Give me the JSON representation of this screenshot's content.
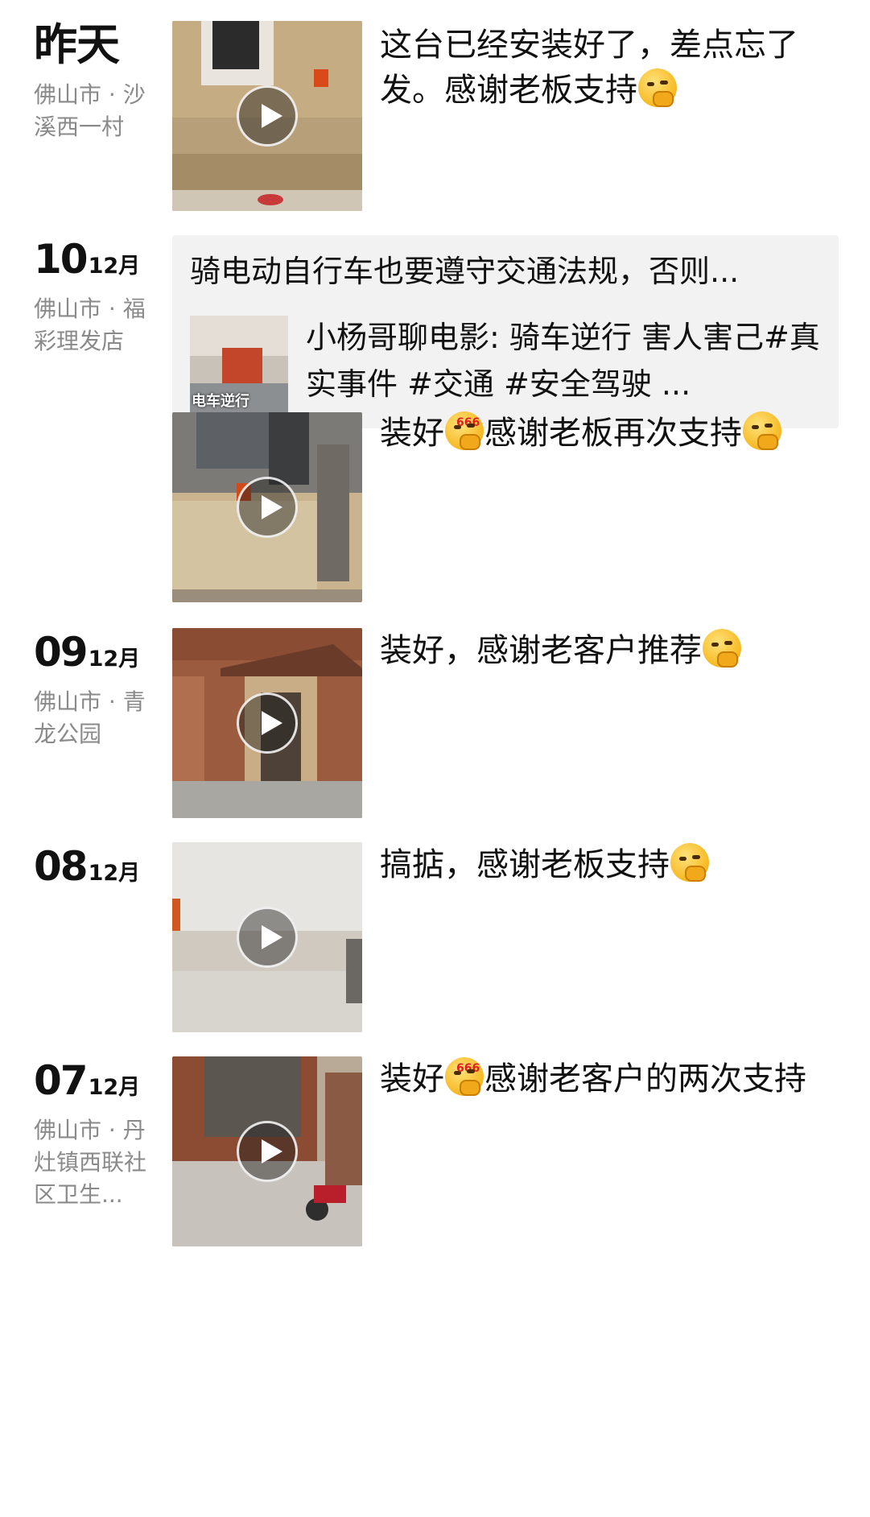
{
  "entries": [
    {
      "date_label": "昨天",
      "location": "佛山市 · 沙溪西一村",
      "caption_text": "这台已经安装好了，差点忘了发。感谢老板支持",
      "emoji": "smirk-thinking-emoji"
    },
    {
      "day": "10",
      "month": "12月",
      "location": "佛山市 · 福彩理发店",
      "share": {
        "title": "骑电动自行车也要遵守交通法规，否则...",
        "thumb_text": "电车逆行",
        "desc": "小杨哥聊电影: 骑车逆行 害人害己#真实事件 #交通 #安全驾驶 ..."
      }
    },
    {
      "caption_part1": "装好",
      "caption_part2": "感谢老板再次支持",
      "emoji_badge": "666"
    },
    {
      "day": "09",
      "month": "12月",
      "location": "佛山市 · 青龙公园",
      "caption_text": "装好，感谢老客户推荐"
    },
    {
      "day": "08",
      "month": "12月",
      "caption_text": "搞掂，感谢老板支持"
    },
    {
      "day": "07",
      "month": "12月",
      "location": "佛山市 · 丹灶镇西联社区卫生...",
      "caption_part1": "装好",
      "caption_part2": "感谢老客户的两次支持",
      "emoji_badge": "666"
    }
  ],
  "icons": {
    "play": "play-icon",
    "emoji": "smirk-thinking-emoji"
  },
  "colors": {
    "background": "#ffffff",
    "text": "#111111",
    "location_text": "#8a8a8a",
    "share_card_bg": "#f2f2f2"
  }
}
